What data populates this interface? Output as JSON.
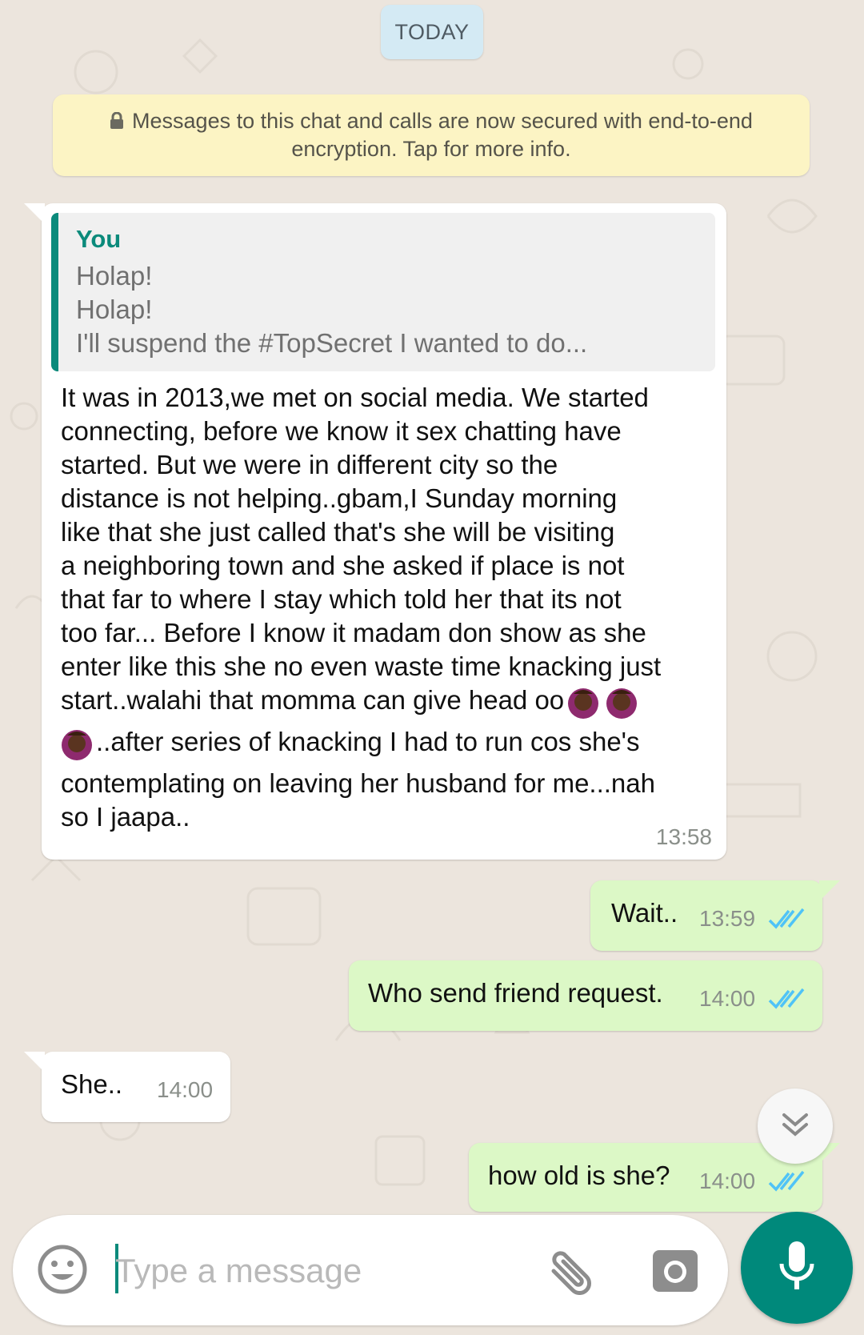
{
  "date_chip": "TODAY",
  "e2e_notice": {
    "line1": "Messages to this chat and calls are now secured with end-to-end",
    "line2": "encryption. Tap for more info."
  },
  "messages": [
    {
      "direction": "incoming",
      "quote": {
        "author": "You",
        "lines": [
          "Holap!",
          "Holap!",
          "I'll suspend the #TopSecret I wanted to do..."
        ]
      },
      "lines": [
        "It was in 2013,we met on social media. We started",
        "connecting, before we know it sex chatting have",
        "started. But we were in different city so the",
        "distance is not helping..gbam,I Sunday morning",
        "like that she just called that's she will be visiting",
        "a neighboring town and she asked if place is not",
        "that far to where I stay which told her that its not",
        "too far... Before I know it madam don show as she",
        "enter like this she no even waste time knacking just",
        "start..walahi that momma can give head oo",
        "..after series of knacking I had to run cos she's",
        "contemplating on leaving her husband for me...nah",
        "so I jaapa.."
      ],
      "emoji": "woman-gesturing-ok",
      "time": "13:58"
    },
    {
      "direction": "outgoing",
      "text": "Wait..",
      "time": "13:59",
      "status": "read"
    },
    {
      "direction": "outgoing",
      "text": "Who send friend request.",
      "time": "14:00",
      "status": "read"
    },
    {
      "direction": "incoming",
      "text": "She..",
      "time": "14:00"
    },
    {
      "direction": "outgoing",
      "text": "how old is she?",
      "time": "14:00",
      "status": "read"
    }
  ],
  "input": {
    "placeholder": "Type a message",
    "value": ""
  },
  "icons": {
    "emoji": "smiley-icon",
    "attach": "paperclip-icon",
    "camera": "camera-icon",
    "mic": "mic-icon",
    "scroll": "chevron-double-down-icon"
  },
  "colors": {
    "accent": "#00897B",
    "outgoing_bubble": "#DCF8C6",
    "incoming_bubble": "#FFFFFF",
    "read_ticks": "#4FC3F7",
    "wallpaper": "#ECE5DD"
  }
}
